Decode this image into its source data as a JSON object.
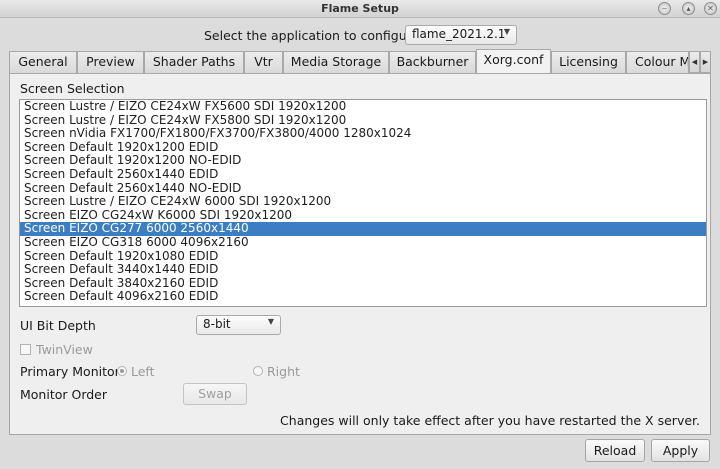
{
  "window": {
    "title": "Flame Setup"
  },
  "app_selector": {
    "label": "Select the application to configure",
    "selected": "flame_2021.2.1"
  },
  "tabs": [
    {
      "label": "General"
    },
    {
      "label": "Preview"
    },
    {
      "label": "Shader Paths"
    },
    {
      "label": "Vtr"
    },
    {
      "label": "Media Storage"
    },
    {
      "label": "Backburner"
    },
    {
      "label": "Xorg.conf"
    },
    {
      "label": "Licensing"
    },
    {
      "label": "Colour Ma"
    }
  ],
  "active_tab": "Xorg.conf",
  "screen_selection": {
    "label": "Screen Selection",
    "items": [
      "Screen Lustre / EIZO CE24xW FX5600 SDI 1920x1200",
      "Screen Lustre / EIZO CE24xW FX5800 SDI 1920x1200",
      "Screen nVidia FX1700/FX1800/FX3700/FX3800/4000 1280x1024",
      "Screen Default 1920x1200 EDID",
      "Screen Default 1920x1200 NO-EDID",
      "Screen Default 2560x1440 EDID",
      "Screen Default 2560x1440 NO-EDID",
      "Screen Lustre / EIZO CE24xW 6000 SDI 1920x1200",
      "Screen EIZO CG24xW K6000 SDI 1920x1200",
      "Screen EIZO CG277 6000 2560x1440",
      "Screen EIZO CG318 6000 4096x2160",
      "Screen Default 1920x1080 EDID",
      "Screen Default 3440x1440 EDID",
      "Screen Default 3840x2160 EDID",
      "Screen Default 4096x2160 EDID"
    ],
    "selected_item": "Screen EIZO CG277 6000 2560x1440"
  },
  "ui_bit_depth": {
    "label": "UI Bit Depth",
    "value": "8-bit"
  },
  "twinview": {
    "label": "TwinView",
    "checked": false
  },
  "primary_monitor": {
    "label": "Primary Monitor",
    "left": "Left",
    "right": "Right",
    "selected": "Left"
  },
  "monitor_order": {
    "label": "Monitor Order",
    "swap": "Swap"
  },
  "notice": "Changes will only take effect after you have restarted the X server.",
  "footer": {
    "reload": "Reload",
    "apply": "Apply"
  }
}
